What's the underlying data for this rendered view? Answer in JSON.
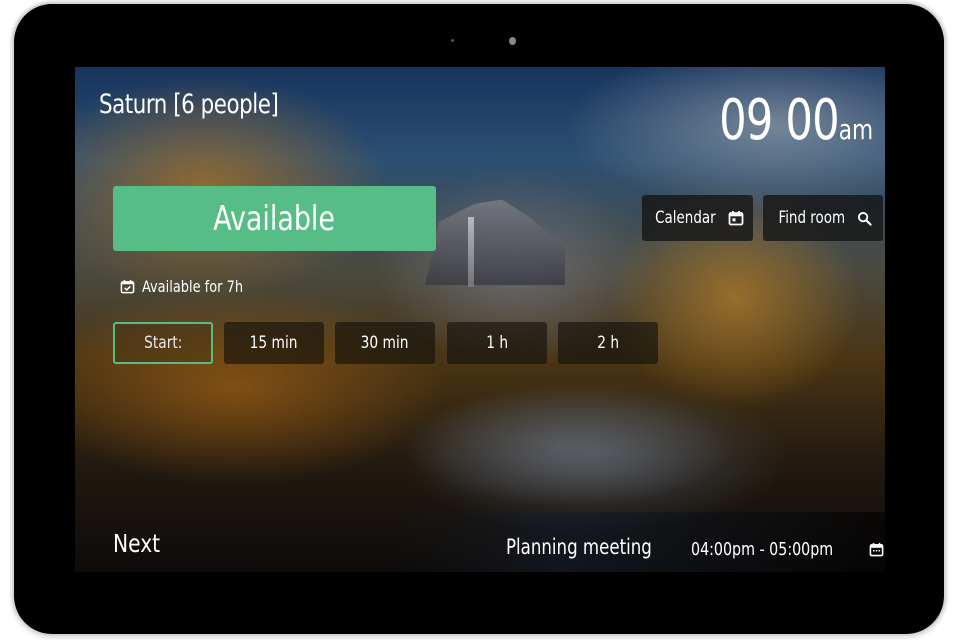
{
  "room": {
    "name": "Saturn [6 people]"
  },
  "clock": {
    "time": "09 00",
    "ampm": "am"
  },
  "status": {
    "label": "Available",
    "color": "#56bd87",
    "availability": "Available for 7h"
  },
  "header_buttons": {
    "calendar": {
      "label": "Calendar",
      "icon": "calendar-icon"
    },
    "find_room": {
      "label": "Find room",
      "icon": "search-icon"
    }
  },
  "booking": {
    "start_label": "Start:",
    "durations": [
      "15 min",
      "30 min",
      "1 h",
      "2 h"
    ]
  },
  "next": {
    "label": "Next",
    "meeting_title": "Planning meeting",
    "meeting_time": "04:00pm - 05:00pm",
    "icon": "calendar-icon"
  }
}
